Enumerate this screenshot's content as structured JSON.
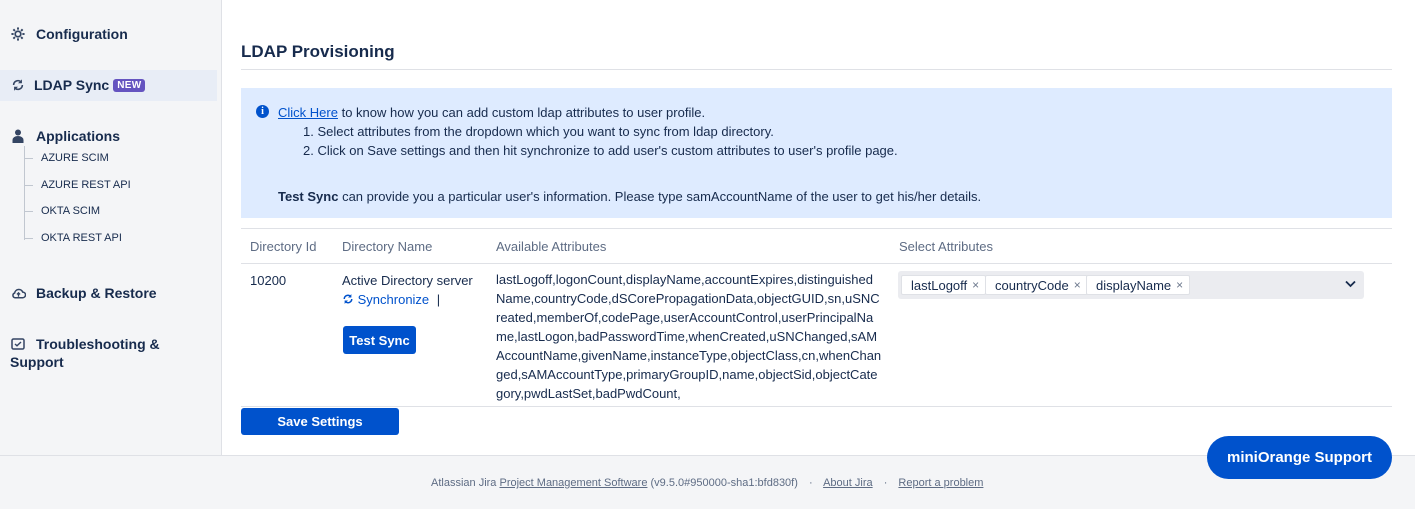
{
  "sidebar": {
    "configuration": "Configuration",
    "ldap_sync": "LDAP Sync",
    "ldap_sync_badge": "NEW",
    "applications": "Applications",
    "apps": [
      "AZURE SCIM",
      "AZURE REST API",
      "OKTA SCIM",
      "OKTA REST API"
    ],
    "backup": "Backup & Restore",
    "troubleshooting_line1": "Troubleshooting &",
    "troubleshooting_line2": "Support"
  },
  "main": {
    "title": "LDAP Provisioning",
    "info": {
      "link": "Click Here",
      "line1_rest": " to know how you can add custom ldap attributes to user profile.",
      "step1": "1. Select attributes from the dropdown which you want to sync from ldap directory.",
      "step2": "2. Click on Save settings and then hit synchronize to add user's custom attributes to user's profile page.",
      "test_sync_bold": "Test Sync",
      "test_sync_rest": " can provide you a particular user's information. Please type samAccountName of the user to get his/her details."
    },
    "table": {
      "headers": [
        "Directory Id",
        "Directory Name",
        "Available Attributes",
        "Select Attributes"
      ],
      "row": {
        "directory_id": "10200",
        "directory_name": "Active Directory server",
        "synchronize": "Synchronize",
        "separator": "|",
        "test_sync_button": "Test Sync",
        "available_attributes": "lastLogoff,logonCount,displayName,accountExpires,distinguishedName,countryCode,dSCorePropagationData,objectGUID,sn,uSNCreated,memberOf,codePage,userAccountControl,userPrincipalName,lastLogon,badPasswordTime,whenCreated,uSNChanged,sAMAccountName,givenName,instanceType,objectClass,cn,whenChanged,sAMAccountType,primaryGroupID,name,objectSid,objectCategory,pwdLastSet,badPwdCount,",
        "selected": [
          "lastLogoff",
          "countryCode",
          "displayName"
        ]
      }
    },
    "save_button": "Save Settings"
  },
  "support_button": "miniOrange Support",
  "footer": {
    "prefix": "Atlassian Jira ",
    "pms_link": "Project Management Software",
    "version": " (v9.5.0#950000-sha1:bfd830f)",
    "sep": "·",
    "about": "About Jira",
    "report": "Report a problem"
  },
  "colors": {
    "primary": "#0052cc",
    "info_bg": "#deebff",
    "badge": "#6554c0",
    "sidebar_bg": "#f4f5f7"
  },
  "icons": {
    "configuration": "gear-icon",
    "ldap_sync": "sync-icon",
    "applications": "user-icon",
    "backup": "cloud-icon",
    "troubleshooting": "support-icon",
    "info": "info-icon",
    "dropdown": "chevron-down-icon"
  }
}
